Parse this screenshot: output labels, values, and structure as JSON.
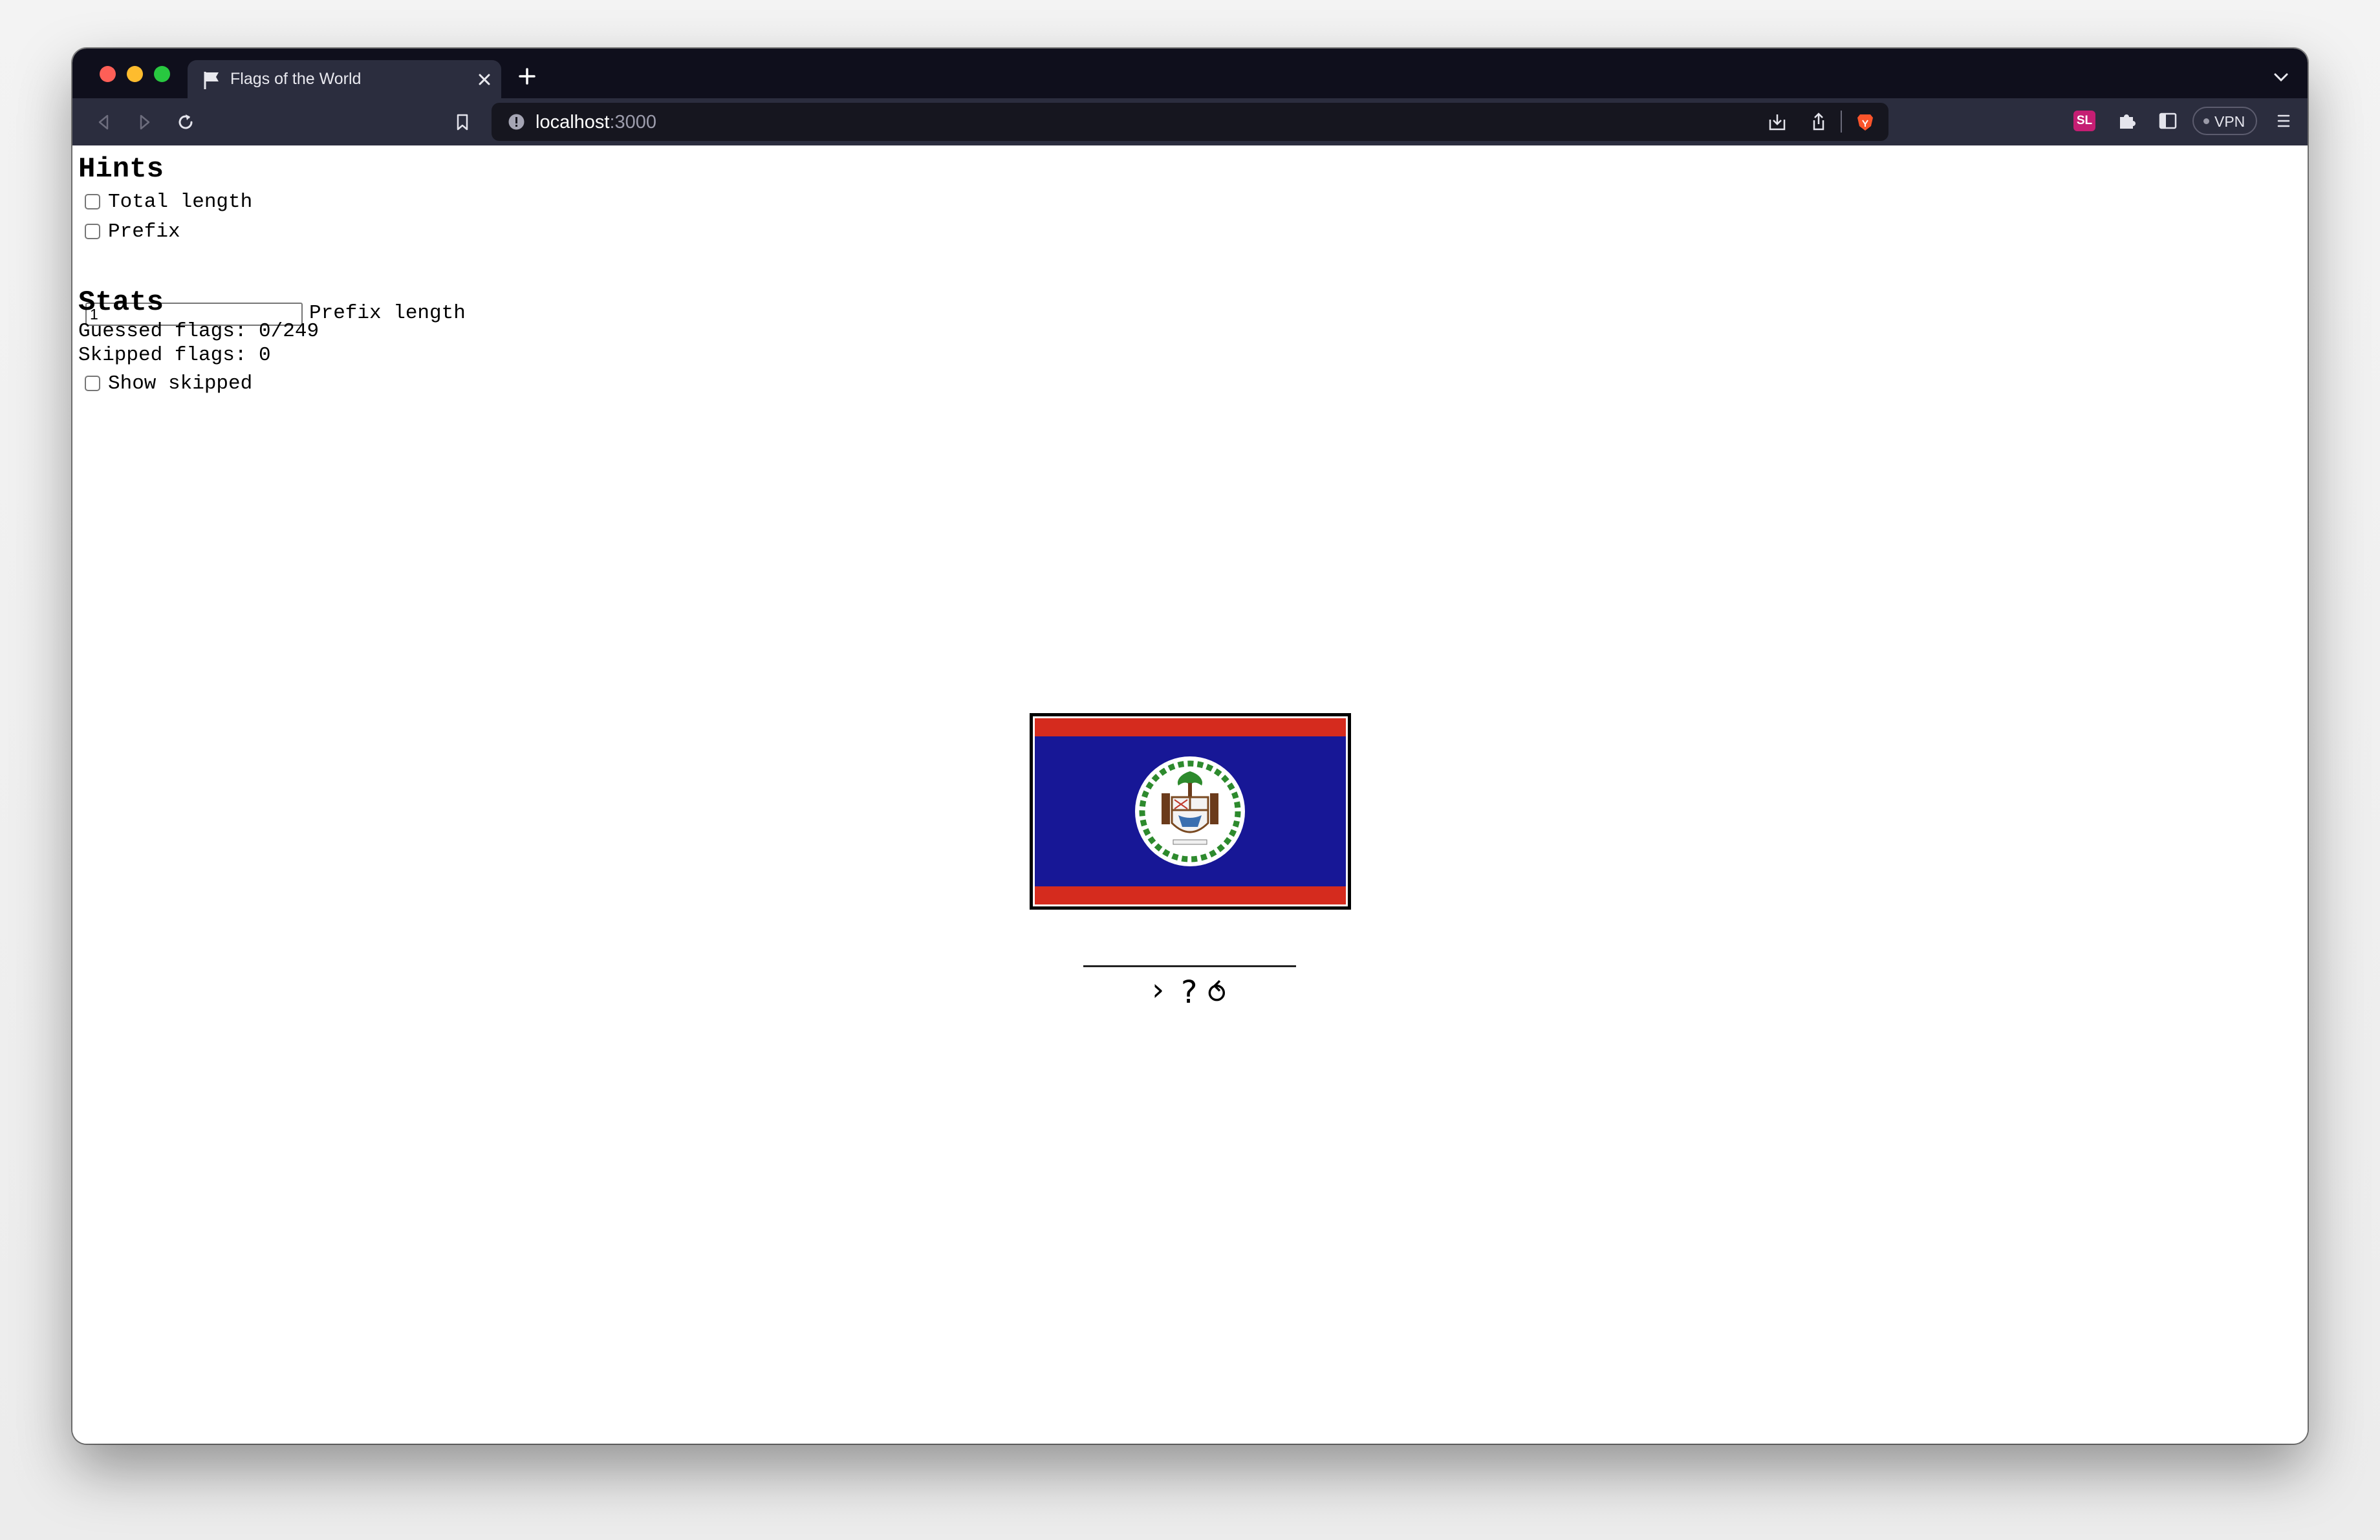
{
  "browser": {
    "tab_title": "Flags of the World",
    "url_host": "localhost",
    "url_port": ":3000",
    "extension_badge": "SL",
    "vpn_label": "VPN"
  },
  "hints": {
    "heading": "Hints",
    "total_length_label": "Total length",
    "total_length_checked": false,
    "prefix_label": "Prefix",
    "prefix_checked": false,
    "prefix_length_value": "1",
    "prefix_length_label": "Prefix length"
  },
  "stats": {
    "heading": "Stats",
    "guessed_text": "Guessed flags: 0/249",
    "skipped_text": "Skipped flags: 0",
    "show_skipped_label": "Show skipped",
    "show_skipped_checked": false
  },
  "controls": {
    "next_symbol": "›",
    "hint_symbol": "?",
    "restart_symbol": "⥀"
  },
  "colors": {
    "flag_red": "#d52b1e",
    "flag_blue": "#171796",
    "chrome_dark": "#0f0f1c",
    "chrome_toolbar": "#2b2d3e",
    "brave_orange": "#fb542b"
  },
  "icons": [
    "flag-icon",
    "close-icon",
    "plus-icon",
    "back-icon",
    "forward-icon",
    "reload-icon",
    "bookmark-icon",
    "info-icon",
    "download-icon",
    "share-icon",
    "brave-lion-icon",
    "puzzle-icon",
    "sidebar-icon",
    "menu-icon",
    "chevron-down-icon"
  ]
}
